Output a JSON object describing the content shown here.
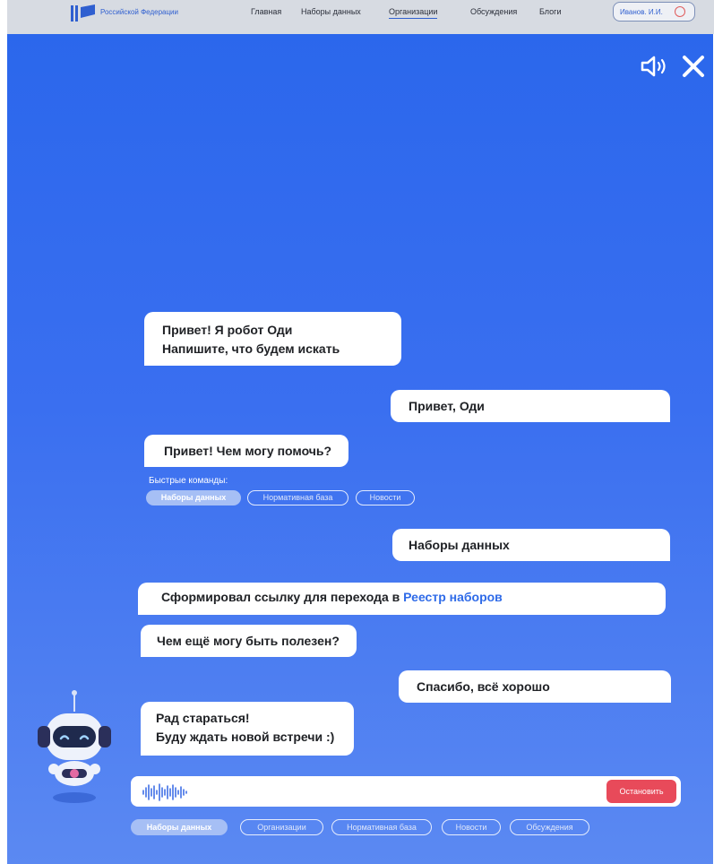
{
  "header": {
    "logo_text": "Российской Федерации",
    "nav": [
      {
        "label": "Главная"
      },
      {
        "label": "Наборы данных"
      },
      {
        "label": "Организации"
      },
      {
        "label": "Обсуждения"
      },
      {
        "label": "Блоги"
      }
    ],
    "active_nav": "Организации",
    "user_label": "Иванов. И.И."
  },
  "chat": {
    "messages": [
      {
        "from": "bot",
        "lines": [
          "Привет! Я робот Оди",
          "Напишите, что будем искать"
        ]
      },
      {
        "from": "user",
        "lines": [
          "Привет, Оди"
        ]
      },
      {
        "from": "bot",
        "lines": [
          "Привет! Чем могу помочь?"
        ]
      },
      {
        "from": "user",
        "lines": [
          "Наборы данных"
        ]
      },
      {
        "from": "bot",
        "text": "Сформировал ссылку для перехода в ",
        "link": "Реестр наборов"
      },
      {
        "from": "bot",
        "lines": [
          "Чем ещё могу быть полезен?"
        ]
      },
      {
        "from": "user",
        "lines": [
          "Спасибо, всё хорошо"
        ]
      },
      {
        "from": "bot",
        "lines": [
          "Рад стараться!",
          "Буду ждать новой встречи :)"
        ]
      }
    ],
    "quick_commands": {
      "title": "Быстрые команды:",
      "items": [
        "Наборы данных",
        "Нормативная база",
        "Новости"
      ],
      "active": "Наборы данных"
    }
  },
  "input": {
    "stop_label": "Остановить",
    "recording": true
  },
  "bottom_chips": {
    "items": [
      "Наборы данных",
      "Организации",
      "Нормативная база",
      "Новости",
      "Обсуждения"
    ],
    "active": "Наборы данных"
  },
  "colors": {
    "accent": "#2f6be8",
    "background_top": "#2b67ec",
    "stop_button": "#e84a5a"
  },
  "icons": {
    "sound": "speaker-icon",
    "close": "close-icon",
    "voice": "waveform-icon",
    "assistant": "robot-avatar"
  }
}
